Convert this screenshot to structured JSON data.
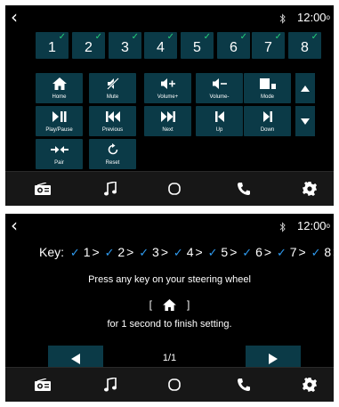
{
  "status": {
    "time": "12:00",
    "bluetooth_icon": "bluetooth-icon"
  },
  "keys": [
    {
      "label": "1",
      "checked": true
    },
    {
      "label": "2",
      "checked": true
    },
    {
      "label": "3",
      "checked": true
    },
    {
      "label": "4",
      "checked": true
    },
    {
      "label": "5",
      "checked": true
    },
    {
      "label": "6",
      "checked": true
    },
    {
      "label": "7",
      "checked": true
    },
    {
      "label": "8",
      "checked": true
    }
  ],
  "check_glyph": "✓",
  "functions": [
    {
      "label": "Home",
      "icon": "home-icon"
    },
    {
      "label": "Mute",
      "icon": "mute-icon"
    },
    {
      "label": "Volume+",
      "icon": "volume-up-icon"
    },
    {
      "label": "Volume-",
      "icon": "volume-down-icon"
    },
    {
      "label": "Mode",
      "icon": "mode-icon"
    },
    {
      "label": "Play/Pause",
      "icon": "play-pause-icon"
    },
    {
      "label": "Previous",
      "icon": "previous-icon"
    },
    {
      "label": "Next",
      "icon": "next-icon"
    },
    {
      "label": "Up",
      "icon": "up-icon"
    },
    {
      "label": "Down",
      "icon": "down-icon"
    },
    {
      "label": "Pair",
      "icon": "pair-icon"
    },
    {
      "label": "Reset",
      "icon": "reset-icon"
    }
  ],
  "nav": [
    "radio-icon",
    "music-icon",
    "home-circle-icon",
    "phone-icon",
    "settings-icon"
  ],
  "setup": {
    "key_prefix": "Key:",
    "keys": [
      "1",
      "2",
      "3",
      "4",
      "5",
      "6",
      "7",
      "8"
    ],
    "arrow": ">",
    "instruction1": "Press any key on your steering wheel",
    "bracket_open": "[",
    "bracket_close": "]",
    "instruction2": "for 1 second to finish setting.",
    "page": "1/1"
  },
  "colors": {
    "button_bg": "#0b3a47",
    "check_green": "#27d07a",
    "check_blue": "#2f9bf0",
    "nav_bg": "#171717"
  }
}
